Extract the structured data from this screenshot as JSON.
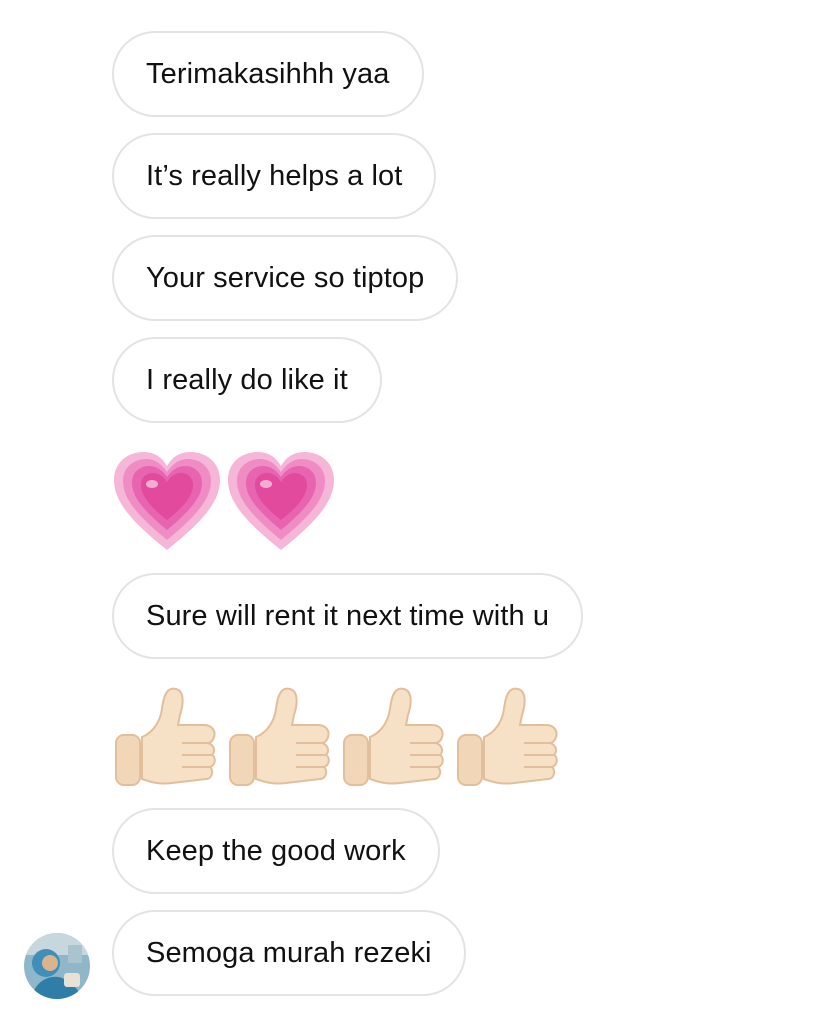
{
  "messages": [
    {
      "type": "text",
      "text": "Terimakasihhh yaa"
    },
    {
      "type": "text",
      "text": "It’s really helps a lot"
    },
    {
      "type": "text",
      "text": "Your service so tiptop"
    },
    {
      "type": "text",
      "text": "I really do like it"
    },
    {
      "type": "emoji",
      "icon": "growing-heart-icon",
      "count": 2
    },
    {
      "type": "text",
      "text": "Sure will rent it next time with u"
    },
    {
      "type": "emoji",
      "icon": "thumbs-up-icon",
      "count": 4
    },
    {
      "type": "text",
      "text": "Keep the good work"
    },
    {
      "type": "text",
      "text": "Semoga murah rezeki"
    }
  ],
  "colors": {
    "bubble_border": "#e3e3e3",
    "text": "#111111",
    "heart_pink": "#e24a9e",
    "thumb_skin": "#f4dcc0"
  }
}
